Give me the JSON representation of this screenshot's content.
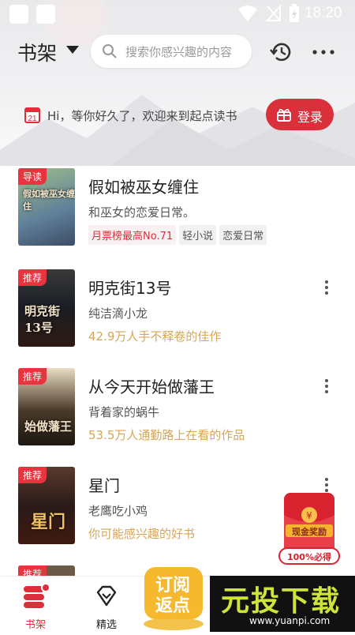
{
  "status_bar": {
    "time": "18:20"
  },
  "top_bar": {
    "title": "书架",
    "search_placeholder": "搜索你感兴趣的内容"
  },
  "welcome": {
    "calendar_day": "21",
    "text": "Hi，等你好久了，欢迎来到起点读书",
    "login_label": "登录"
  },
  "books": [
    {
      "cover_tag": "导读",
      "cover_art": "假如被巫女缠住",
      "title": "假如被巫女缠住",
      "subtitle": "和巫女的恋爱日常。",
      "tags": [
        "月票榜最高No.71",
        "轻小说",
        "恋爱日常"
      ]
    },
    {
      "cover_tag": "推荐",
      "cover_art": "明克街13号",
      "title": "明克街13号",
      "subtitle": "纯洁滴小龙",
      "desc": "42.9万人手不释卷的佳作"
    },
    {
      "cover_tag": "推荐",
      "cover_art": "始做藩王",
      "title": "从今天开始做藩王",
      "subtitle": "背着家的蜗牛",
      "desc": "53.5万人通勤路上在看的作品"
    },
    {
      "cover_tag": "推荐",
      "cover_art": "星门",
      "title": "星门",
      "subtitle": "老鹰吃小鸡",
      "desc": "你可能感兴趣的好书"
    },
    {
      "cover_tag": "推荐"
    }
  ],
  "red_packet": {
    "label": "现金奖励",
    "badge": "100%必得"
  },
  "promo": {
    "line1": "订阅",
    "line2": "返点"
  },
  "tabbar": {
    "tabs": [
      {
        "label": "书架"
      },
      {
        "label": "精选"
      }
    ]
  },
  "watermark": {
    "cn": "元投下载",
    "url": "www.yuanpi.com"
  },
  "colors": {
    "accent": "#d9303c",
    "desc_gold": "#d6a659"
  }
}
